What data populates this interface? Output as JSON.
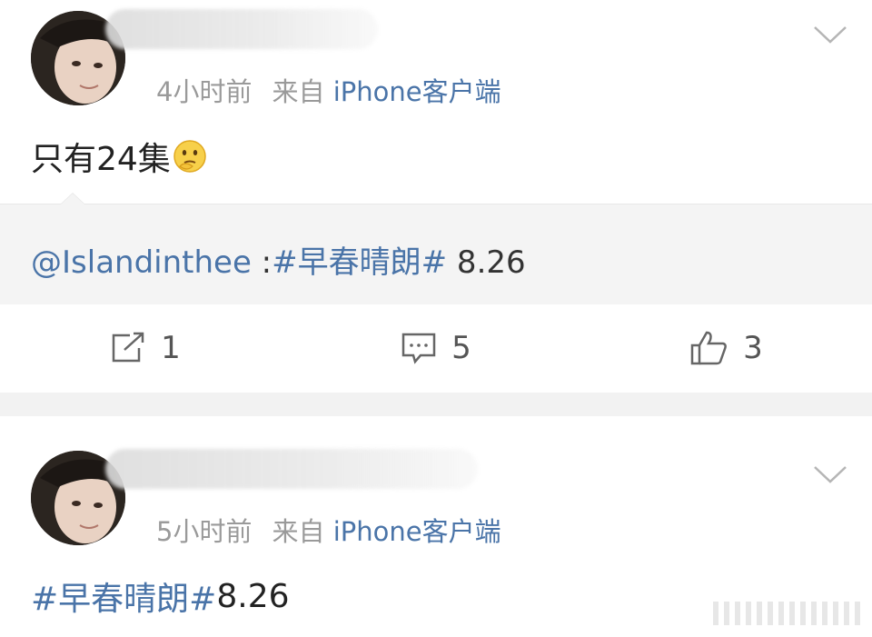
{
  "posts": [
    {
      "time": "4小时前",
      "source_prefix": "来自",
      "source_device": "iPhone客户端",
      "text": "只有24集",
      "emoji_icon": "thinking-face-icon",
      "repost": {
        "mention": "@Islandinthee",
        "separator": " :",
        "hashtag": "#早春晴朗#",
        "tail": " 8.26"
      },
      "actions": {
        "share_count": "1",
        "comment_count": "5",
        "like_count": "3"
      }
    },
    {
      "time": "5小时前",
      "source_prefix": "来自",
      "source_device": "iPhone客户端",
      "hashtag": "#早春晴朗#",
      "tail": " 8.26"
    }
  ],
  "icons": {
    "more": "chevron-down-icon",
    "share": "share-icon",
    "comment": "comment-icon",
    "like": "thumbs-up-icon"
  },
  "colors": {
    "link_blue": "#4a74a8",
    "meta_gray": "#9a9a9a",
    "repost_bg": "#f4f4f4",
    "band_bg": "#f2f2f2"
  }
}
